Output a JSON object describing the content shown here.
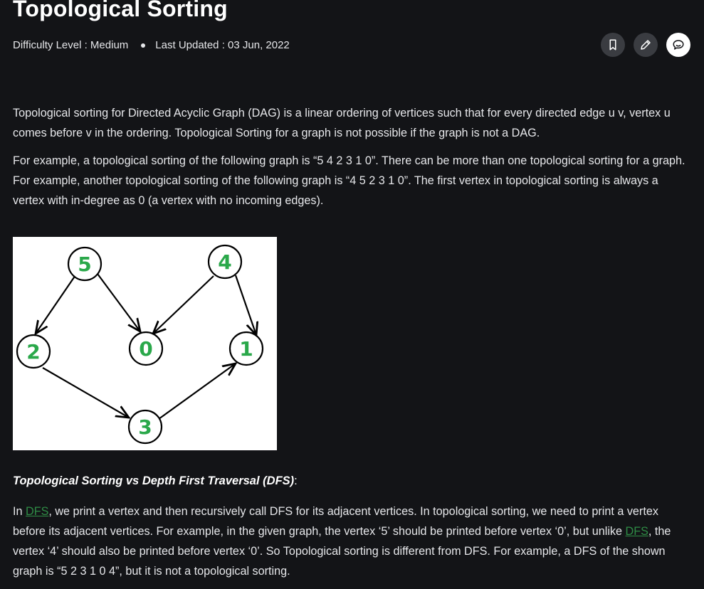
{
  "article": {
    "title": "Topological Sorting",
    "difficulty_label": "Difficulty Level : Medium",
    "last_updated": "Last Updated : 03 Jun, 2022"
  },
  "icons": {
    "bookmark": "bookmark-icon",
    "edit": "pencil-icon",
    "discuss": "chat-icon"
  },
  "paragraphs": {
    "p1": "Topological sorting for Directed Acyclic Graph (DAG) is a linear ordering of vertices such that for every directed edge u v, vertex u comes before v in the ordering. Topological Sorting for a graph is not possible if the graph is not a DAG.",
    "p2": "For example, a topological sorting of the following graph is “5 4 2 3 1 0”. There can be more than one topological sorting for a graph. For example, another topological sorting of the following graph is “4 5 2 3 1 0”. The first vertex in topological sorting is always a vertex with in-degree as 0 (a vertex with no incoming edges)."
  },
  "graph": {
    "nodes": [
      "5",
      "4",
      "2",
      "0",
      "1",
      "3"
    ],
    "node_color": "#2aa84a"
  },
  "section": {
    "heading": "Topological Sorting vs Depth First Traversal (DFS)",
    "colon": ":",
    "p3_in": "In ",
    "dfs_link_1": "DFS",
    "p3_a": ", we print a vertex and then recursively call DFS for its adjacent vertices. In topological sorting, we need to print a vertex before its adjacent vertices. For example, in the given graph, the vertex ‘5’ should be printed before vertex ‘0’, but unlike ",
    "dfs_link_2": "DFS",
    "p3_b": ", the vertex ‘4’ should also be printed before vertex ‘0’. So Topological sorting is different from DFS. For example, a DFS of the shown graph is “5 2 3 1 0 4”, but it is not a topological sorting."
  },
  "colors": {
    "background": "#131417",
    "text": "#e6e7ea",
    "link": "#2f8d46"
  }
}
